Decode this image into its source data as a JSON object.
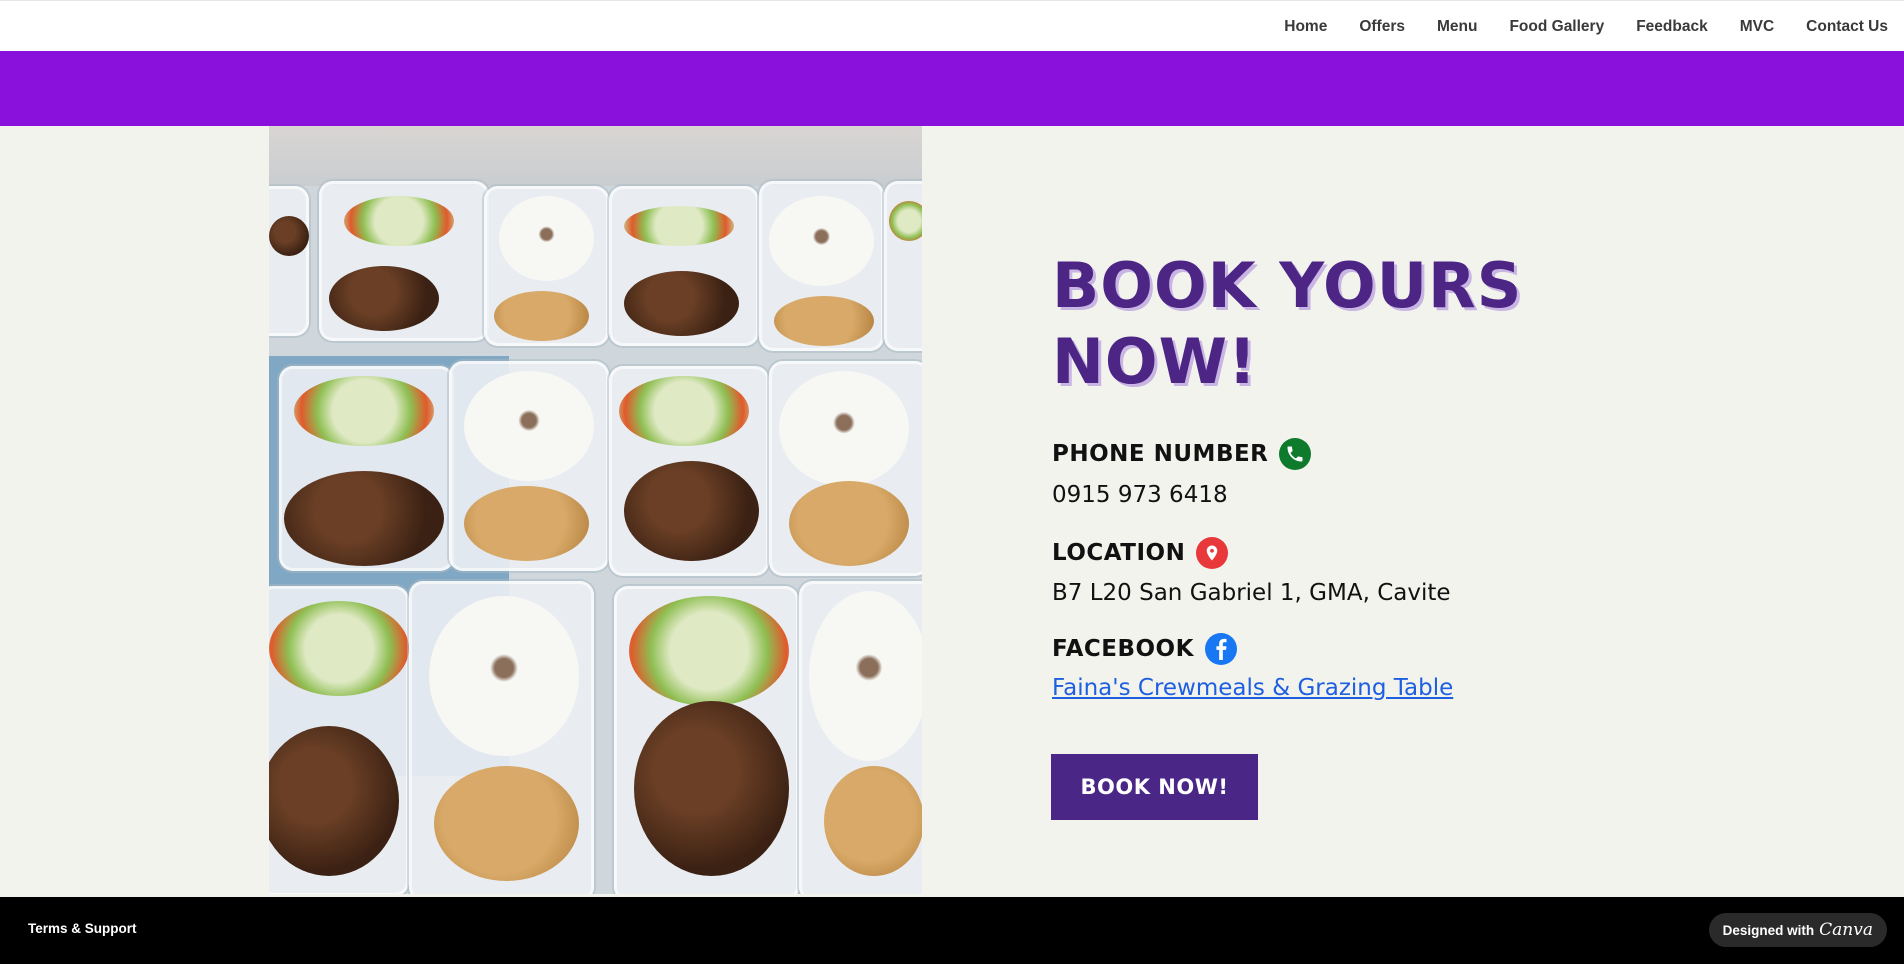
{
  "nav": {
    "items": [
      {
        "label": "Home"
      },
      {
        "label": "Offers"
      },
      {
        "label": "Menu"
      },
      {
        "label": "Food Gallery"
      },
      {
        "label": "Feedback"
      },
      {
        "label": "MVC"
      },
      {
        "label": "Contact Us"
      }
    ]
  },
  "colors": {
    "accent_band": "#8a10dc",
    "title": "#4d2585",
    "button": "#4a2686",
    "phone_icon": "#0e7a2c",
    "location_icon": "#e8383a",
    "facebook_icon": "#1877f2"
  },
  "hero": {
    "title_line1": "BOOK YOURS",
    "title_line2": "NOW!",
    "phone_label": "PHONE NUMBER",
    "phone_value": "0915 973 6418",
    "phone_icon": "phone-icon",
    "location_label": "LOCATION",
    "location_value": "B7 L20 San Gabriel 1, GMA, Cavite",
    "location_icon": "map-pin-icon",
    "facebook_label": "FACEBOOK",
    "facebook_link": "Faina's Crewmeals & Grazing Table",
    "facebook_icon": "facebook-icon",
    "book_button": "BOOK NOW!"
  },
  "footer": {
    "terms": "Terms & Support",
    "designed_with": "Designed with",
    "brand": "Canva"
  }
}
